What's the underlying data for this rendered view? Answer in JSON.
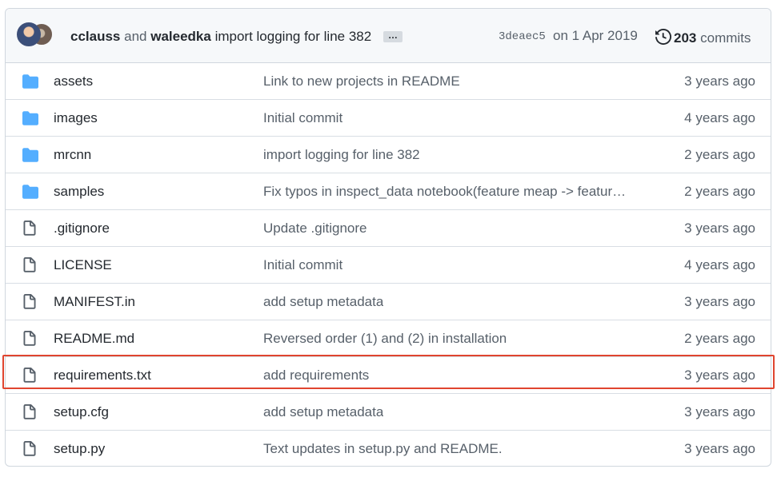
{
  "commit": {
    "author1": "cclauss",
    "and": "and",
    "author2": "waleedka",
    "message": "import logging for line 382",
    "ellipsis": "…",
    "sha": "3deaec5",
    "date": "on 1 Apr 2019",
    "count": "203",
    "commits_label": "commits"
  },
  "colors": {
    "folder": "#54aeff",
    "file": "#57606a",
    "highlight": "#e0452f"
  },
  "files": [
    {
      "name": "assets",
      "type": "folder",
      "message": "Link to new projects in README",
      "age": "3 years ago"
    },
    {
      "name": "images",
      "type": "folder",
      "message": "Initial commit",
      "age": "4 years ago"
    },
    {
      "name": "mrcnn",
      "type": "folder",
      "message": "import logging for line 382",
      "age": "2 years ago"
    },
    {
      "name": "samples",
      "type": "folder",
      "message": "Fix typos in inspect_data notebook(feature meap -> featur…",
      "age": "2 years ago"
    },
    {
      "name": ".gitignore",
      "type": "file",
      "message": "Update .gitignore",
      "age": "3 years ago"
    },
    {
      "name": "LICENSE",
      "type": "file",
      "message": "Initial commit",
      "age": "4 years ago"
    },
    {
      "name": "MANIFEST.in",
      "type": "file",
      "message": "add setup metadata",
      "age": "3 years ago"
    },
    {
      "name": "README.md",
      "type": "file",
      "message": "Reversed order (1) and (2) in installation",
      "age": "2 years ago"
    },
    {
      "name": "requirements.txt",
      "type": "file",
      "message": "add requirements",
      "age": "3 years ago",
      "highlighted": true
    },
    {
      "name": "setup.cfg",
      "type": "file",
      "message": "add setup metadata",
      "age": "3 years ago"
    },
    {
      "name": "setup.py",
      "type": "file",
      "message": "Text updates in setup.py and README.",
      "age": "3 years ago"
    }
  ]
}
